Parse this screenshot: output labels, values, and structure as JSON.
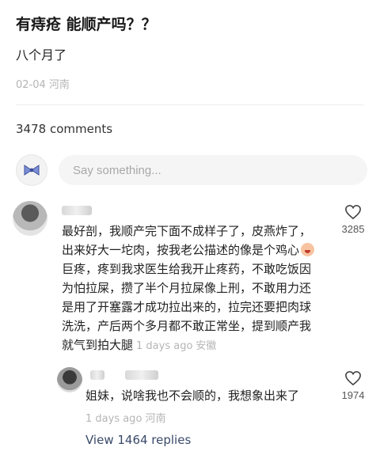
{
  "post": {
    "title": "有痔疮 能顺产吗？？",
    "body": "八个月了",
    "date": "02-04",
    "location": "河南"
  },
  "comments_header": {
    "count_label": "3478 comments"
  },
  "composer": {
    "avatar_icon": "bow-icon",
    "placeholder": "Say something..."
  },
  "comment": {
    "lines": [
      "最好剖，我顺产完下面不成样子了，皮燕炸了，",
      "出来好大一坨肉，按我老公描述的像是个鸡心",
      "巨疼，疼到我求医生给我开止疼药，不敢吃饭因",
      "为怕拉屎，攒了半个月拉屎像上刑，不敢用力还",
      "是用了开塞露才成功拉出来的，拉完还要把肉球",
      "洗洗，产后两个多月都不敢正常坐，提到顺产我",
      "就气到拍大腿"
    ],
    "time": "1 days ago",
    "location": "安徽",
    "likes": "3285"
  },
  "reply": {
    "text": "姐妹，说啥我也不会顺的，我想象出来了",
    "time": "1 days ago",
    "location": "河南",
    "likes": "1974"
  },
  "view_replies_label": "View 1464 replies"
}
